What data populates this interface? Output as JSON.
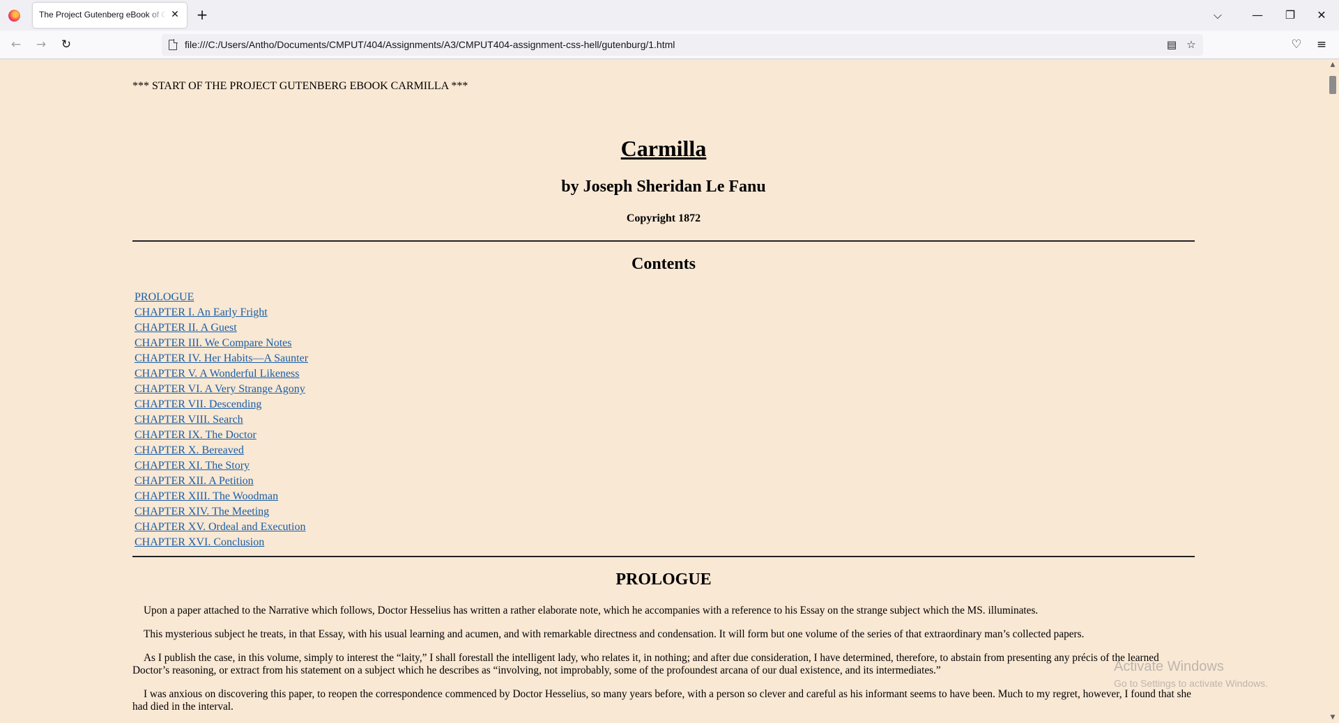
{
  "browser": {
    "tab_title": "The Project Gutenberg eBook of Carmilla, by Joseph Sheridan Le Fanu",
    "new_tab_symbol": "+",
    "close_tab_symbol": "✕",
    "url": "file:///C:/Users/Antho/Documents/CMPUT/404/Assignments/A3/CMPUT404-assignment-css-hell/gutenburg/1.html",
    "window_controls": {
      "list_all_tabs": "⌵",
      "minimize": "—",
      "restore": "❐",
      "close": "✕"
    },
    "nav": {
      "back": "←",
      "forward": "→",
      "reload": "↻"
    },
    "url_actions": {
      "reader_view": "▤",
      "bookmark": "☆"
    },
    "toolbar": {
      "pocket": "♡",
      "menu": "≡"
    }
  },
  "page": {
    "start_line": "*** START OF THE PROJECT GUTENBERG EBOOK CARMILLA ***",
    "title": "Carmilla",
    "author": "by Joseph Sheridan Le Fanu",
    "copyright": "Copyright 1872",
    "contents_heading": "Contents",
    "toc": [
      "PROLOGUE",
      "CHAPTER I. An Early Fright",
      "CHAPTER II. A Guest",
      "CHAPTER III. We Compare Notes",
      "CHAPTER IV. Her Habits—A Saunter",
      "CHAPTER V. A Wonderful Likeness",
      "CHAPTER VI. A Very Strange Agony",
      "CHAPTER VII. Descending",
      "CHAPTER VIII. Search",
      "CHAPTER IX. The Doctor",
      "CHAPTER X. Bereaved",
      "CHAPTER XI. The Story",
      "CHAPTER XII. A Petition",
      "CHAPTER XIII. The Woodman",
      "CHAPTER XIV. The Meeting",
      "CHAPTER XV. Ordeal and Execution",
      "CHAPTER XVI. Conclusion"
    ],
    "prologue_heading": "PROLOGUE",
    "paragraphs": [
      "Upon a paper attached to the Narrative which follows, Doctor Hesselius has written a rather elaborate note, which he accompanies with a reference to his Essay on the strange subject which the MS. illuminates.",
      "This mysterious subject he treats, in that Essay, with his usual learning and acumen, and with remarkable directness and condensation. It will form but one volume of the series of that extraordinary man’s collected papers.",
      "As I publish the case, in this volume, simply to interest the “laity,” I shall forestall the intelligent lady, who relates it, in nothing; and after due consideration, I have determined, therefore, to abstain from presenting any précis of the learned Doctor’s reasoning, or extract from his statement on a subject which he describes as “involving, not improbably, some of the profoundest arcana of our dual existence, and its intermediates.”",
      "I was anxious on discovering this paper, to reopen the correspondence commenced by Doctor Hesselius, so many years before, with a person so clever and careful as his informant seems to have been. Much to my regret, however, I found that she had died in the interval."
    ]
  },
  "watermark": {
    "title": "Activate Windows",
    "subtitle": "Go to Settings to activate Windows."
  },
  "colors": {
    "page_background": "#f9e8d4",
    "link": "#1a5ea6",
    "chrome_tabbar": "#f0f0f4",
    "chrome_navbar": "#f9f9fb"
  },
  "icons": [
    "firefox-logo-icon",
    "close-icon",
    "plus-icon",
    "chevron-down-icon",
    "minimize-icon",
    "restore-icon",
    "close-window-icon",
    "back-arrow-icon",
    "forward-arrow-icon",
    "reload-icon",
    "page-icon",
    "reader-view-icon",
    "bookmark-star-icon",
    "pocket-icon",
    "hamburger-menu-icon"
  ]
}
